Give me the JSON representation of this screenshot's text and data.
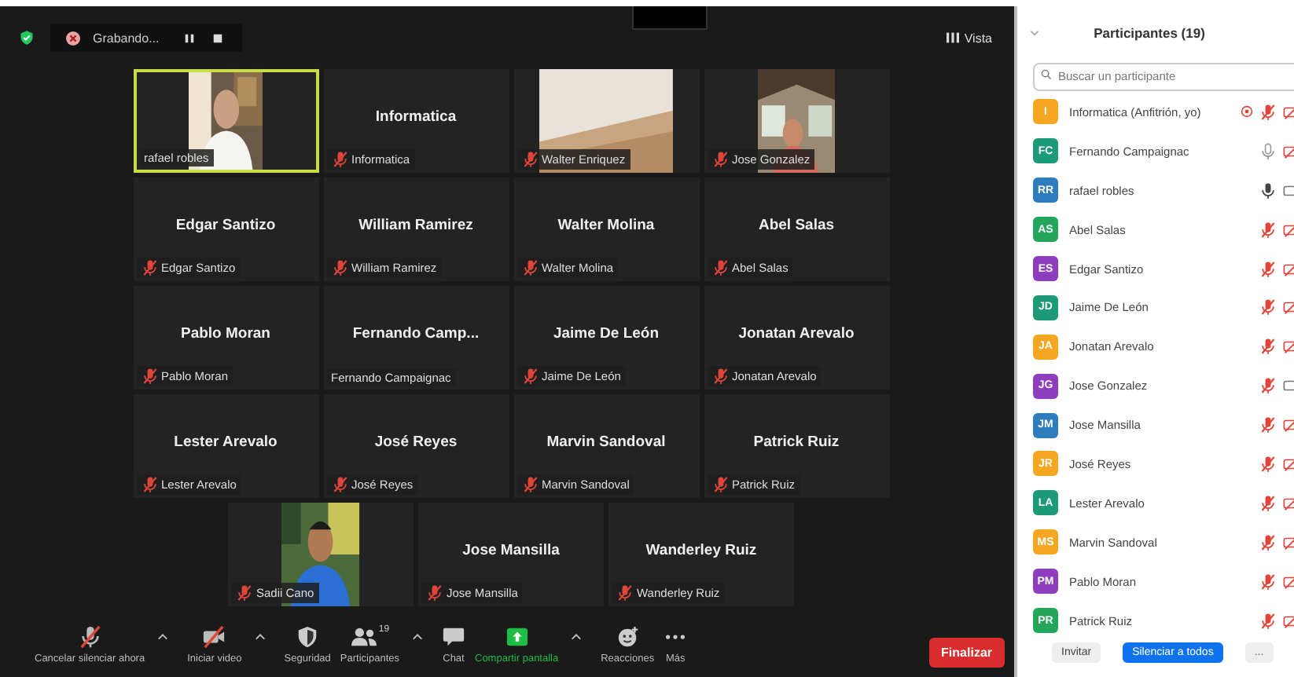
{
  "top_bar": {
    "recording_label": "Grabando...",
    "view_label": "Vista"
  },
  "tiles": [
    {
      "kind": "video",
      "label": "rafael robles",
      "muted": false,
      "active_speaker": true
    },
    {
      "kind": "name",
      "name": "Informatica",
      "label": "Informatica",
      "muted": true,
      "active_speaker": false
    },
    {
      "kind": "video",
      "label": "Walter Enriquez",
      "muted": true,
      "active_speaker": false
    },
    {
      "kind": "video",
      "label": "Jose Gonzalez",
      "muted": true,
      "active_speaker": false
    },
    {
      "kind": "name",
      "name": "Edgar Santizo",
      "label": "Edgar Santizo",
      "muted": true,
      "active_speaker": false
    },
    {
      "kind": "name",
      "name": "William Ramirez",
      "label": "William Ramirez",
      "muted": true,
      "active_speaker": false
    },
    {
      "kind": "name",
      "name": "Walter Molina",
      "label": "Walter Molina",
      "muted": true,
      "active_speaker": false
    },
    {
      "kind": "name",
      "name": "Abel Salas",
      "label": "Abel Salas",
      "muted": true,
      "active_speaker": false
    },
    {
      "kind": "name",
      "name": "Pablo Moran",
      "label": "Pablo Moran",
      "muted": true,
      "active_speaker": false
    },
    {
      "kind": "name",
      "name": "Fernando  Camp...",
      "label": "Fernando Campaignac",
      "muted": false,
      "active_speaker": false
    },
    {
      "kind": "name",
      "name": "Jaime De León",
      "label": "Jaime De León",
      "muted": true,
      "active_speaker": false
    },
    {
      "kind": "name",
      "name": "Jonatan Arevalo",
      "label": "Jonatan Arevalo",
      "muted": true,
      "active_speaker": false
    },
    {
      "kind": "name",
      "name": "Lester Arevalo",
      "label": "Lester Arevalo",
      "muted": true,
      "active_speaker": false
    },
    {
      "kind": "name",
      "name": "José Reyes",
      "label": "José Reyes",
      "muted": true,
      "active_speaker": false
    },
    {
      "kind": "name",
      "name": "Marvin Sandoval",
      "label": "Marvin Sandoval",
      "muted": true,
      "active_speaker": false
    },
    {
      "kind": "name",
      "name": "Patrick Ruiz",
      "label": "Patrick Ruiz",
      "muted": true,
      "active_speaker": false
    },
    {
      "kind": "video",
      "label": "Sadii Cano",
      "muted": true,
      "active_speaker": false
    },
    {
      "kind": "name",
      "name": "Jose Mansilla",
      "label": "Jose Mansilla",
      "muted": true,
      "active_speaker": false
    },
    {
      "kind": "name",
      "name": "Wanderley Ruiz",
      "label": "Wanderley Ruiz",
      "muted": true,
      "active_speaker": false
    }
  ],
  "toolbar": {
    "items": [
      {
        "kind": "mic",
        "label": "Cancelar silenciar ahora",
        "caret": true,
        "muted": true
      },
      {
        "kind": "video",
        "label": "Iniciar video",
        "caret": true,
        "muted": true
      },
      {
        "kind": "security",
        "label": "Seguridad",
        "caret": false
      },
      {
        "kind": "people",
        "label": "Participantes",
        "count": "19",
        "caret": true
      },
      {
        "kind": "chat",
        "label": "Chat",
        "caret": false
      },
      {
        "kind": "share",
        "label": "Compartir pantalla",
        "caret": true
      },
      {
        "kind": "reaction",
        "label": "Reacciones",
        "caret": false
      },
      {
        "kind": "more",
        "label": "Más",
        "caret": false
      }
    ],
    "end_button": "Finalizar"
  },
  "participants": {
    "title": "Participantes (19)",
    "search": {
      "placeholder": "Buscar un participante"
    },
    "items": [
      {
        "initials": "I",
        "name": "Informatica (Anfitrión, yo)",
        "color": "#f5a623",
        "muted": true,
        "video_on": false,
        "raised_icon": true
      },
      {
        "initials": "FC",
        "name": "Fernando Campaignac",
        "color": "#1d9a78",
        "muted": false,
        "speaking": false,
        "video_on": false
      },
      {
        "initials": "RR",
        "name": "rafael robles",
        "color": "#2d7dbe",
        "muted": false,
        "speaking": true,
        "video_on": true
      },
      {
        "initials": "AS",
        "name": "Abel Salas",
        "color": "#23a55a",
        "muted": true,
        "video_on": false
      },
      {
        "initials": "ES",
        "name": "Edgar Santizo",
        "color": "#8e3dbf",
        "muted": true,
        "video_on": false
      },
      {
        "initials": "JD",
        "name": "Jaime De León",
        "color": "#1d9a78",
        "muted": true,
        "video_on": false
      },
      {
        "initials": "JA",
        "name": "Jonatan Arevalo",
        "color": "#f5a623",
        "muted": true,
        "video_on": false
      },
      {
        "initials": "JG",
        "name": "Jose Gonzalez",
        "color": "#8e3dbf",
        "muted": true,
        "video_on": true
      },
      {
        "initials": "JM",
        "name": "Jose Mansilla",
        "color": "#2d7dbe",
        "muted": true,
        "video_on": false
      },
      {
        "initials": "JR",
        "name": "José Reyes",
        "color": "#f5a623",
        "muted": true,
        "video_on": false
      },
      {
        "initials": "LA",
        "name": "Lester Arevalo",
        "color": "#1d9a78",
        "muted": true,
        "video_on": false
      },
      {
        "initials": "MS",
        "name": "Marvin Sandoval",
        "color": "#f5a623",
        "muted": true,
        "video_on": false
      },
      {
        "initials": "PM",
        "name": "Pablo Moran",
        "color": "#8e3dbf",
        "muted": true,
        "video_on": false
      },
      {
        "initials": "PR",
        "name": "Patrick Ruiz",
        "color": "#23a55a",
        "muted": true,
        "video_on": false
      }
    ],
    "buttons": {
      "invite": "Invitar",
      "mute_all": "Silenciar a todos",
      "more": "..."
    }
  }
}
